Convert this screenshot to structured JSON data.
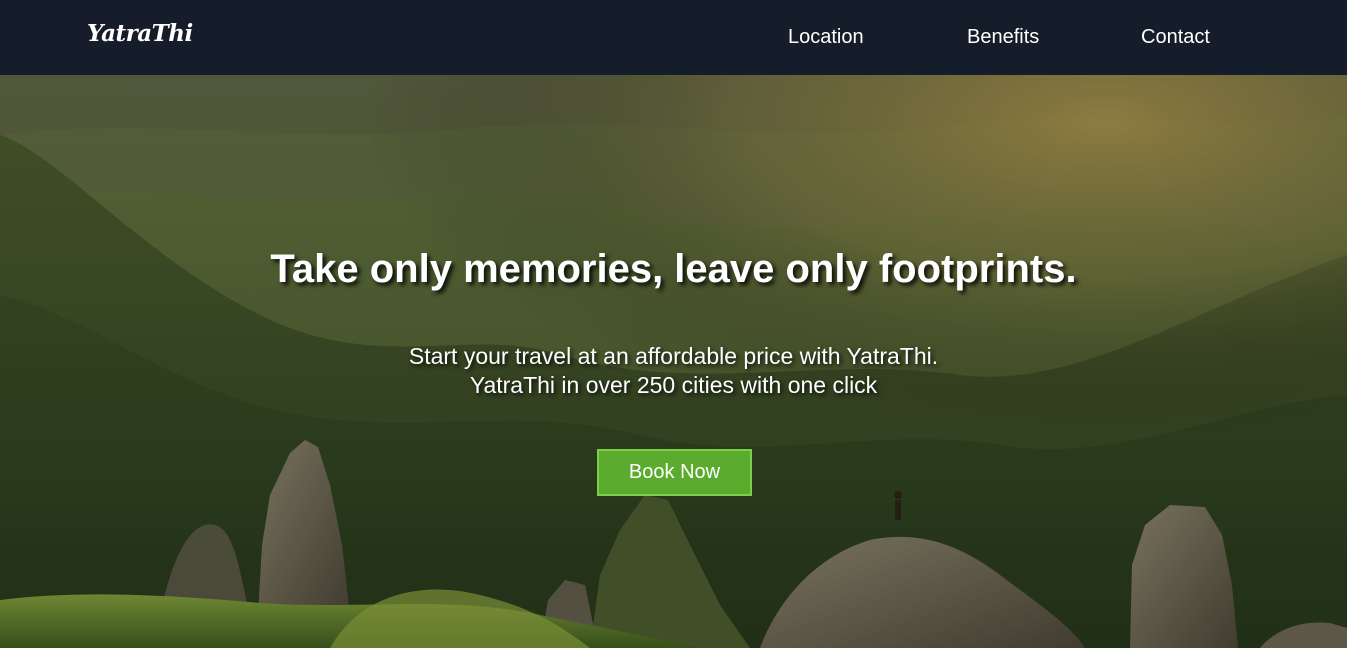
{
  "brand": {
    "logo_text": "YatraThi"
  },
  "nav": {
    "links": [
      {
        "label": "Location"
      },
      {
        "label": "Benefits"
      },
      {
        "label": "Contact"
      }
    ]
  },
  "hero": {
    "headline": "Take only memories, leave only footprints.",
    "subtitle_lines": [
      "Start your travel at an affordable price with YatraThi.",
      "YatraThi in over 250 cities with one click"
    ],
    "cta_label": "Book Now"
  },
  "colors": {
    "navbar_bg": "#151c2a",
    "cta_bg": "#5aab2e",
    "cta_border": "#7ad047",
    "text": "#ffffff"
  }
}
